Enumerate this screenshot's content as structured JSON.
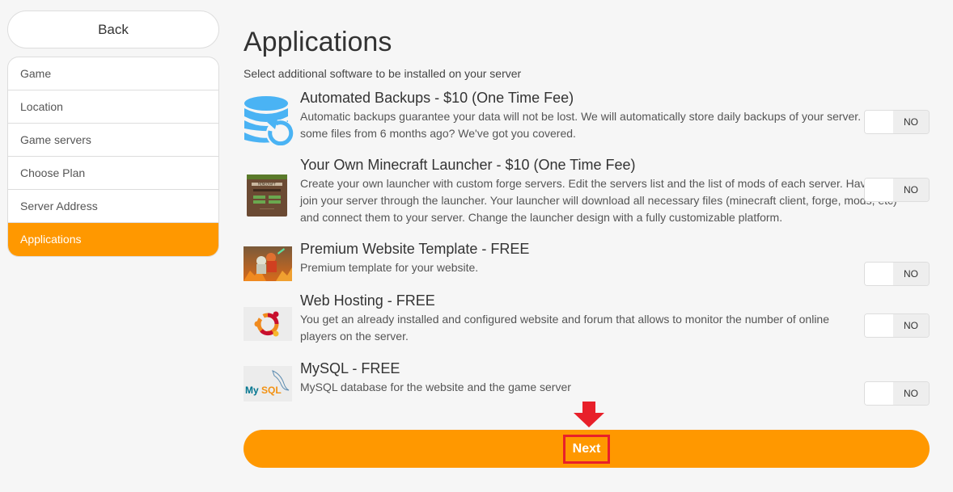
{
  "sidebar": {
    "back_label": "Back",
    "steps": [
      {
        "label": "Game",
        "active": false
      },
      {
        "label": "Location",
        "active": false
      },
      {
        "label": "Game servers",
        "active": false
      },
      {
        "label": "Choose Plan",
        "active": false
      },
      {
        "label": "Server Address",
        "active": false
      },
      {
        "label": "Applications",
        "active": true
      }
    ]
  },
  "main": {
    "title": "Applications",
    "subtitle": "Select additional software to be installed on your server",
    "apps": [
      {
        "icon": "database-backup-icon",
        "title": "Automated Backups - $10 (One Time Fee)",
        "description": "Automatic backups guarantee your data will not be lost. We will automatically store daily backups of your server. Need some files from 6 months ago? We've got you covered.",
        "toggle": "NO"
      },
      {
        "icon": "minecraft-launcher-icon",
        "title": "Your Own Minecraft Launcher - $10 (One Time Fee)",
        "description": "Create your own launcher with custom forge servers. Edit the servers list and the list of mods of each server. Have players join your server through the launcher. Your launcher will download all necessary files (minecraft client, forge, mods, etc) and connect them to your server. Change the launcher design with a fully customizable platform.",
        "toggle": "NO"
      },
      {
        "icon": "website-template-icon",
        "title": "Premium Website Template - FREE",
        "description": "Premium template for your website.",
        "toggle": "NO"
      },
      {
        "icon": "ubuntu-icon",
        "title": "Web Hosting - FREE",
        "description": "You get an already installed and configured website and forum that allows to monitor the number of online players on the server.",
        "toggle": "NO"
      },
      {
        "icon": "mysql-icon",
        "title": "MySQL - FREE",
        "description": "MySQL database for the website and the game server",
        "toggle": "NO"
      }
    ],
    "next_label": "Next",
    "mysql_logo_text": "MySQL",
    "minecraft_logo_text": "MINECRAFT"
  },
  "colors": {
    "accent": "#ff9800",
    "highlight": "#e8202a",
    "backup_icon": "#4ab3f4"
  }
}
